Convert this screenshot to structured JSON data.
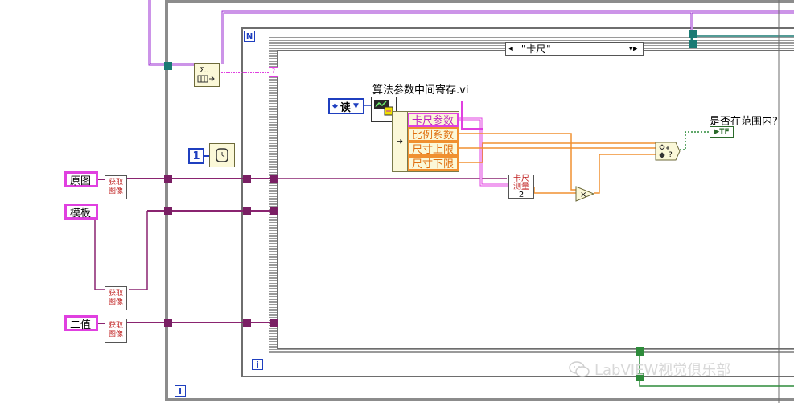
{
  "case_selector": {
    "value": "\"卡尺\"",
    "left_arrow": "◀",
    "right_arrow": "▼▶"
  },
  "terminals": {
    "n": "N",
    "i": "i"
  },
  "loop_count_const": "1",
  "enum_read": {
    "label": "读",
    "arrow": "▼"
  },
  "subvi_name": "算法参数中间寄存.vi",
  "unbundle_items": [
    "卡尺参数",
    "比例系数",
    "尺寸上限",
    "尺寸下限"
  ],
  "images": {
    "original": "原图",
    "template": "模板",
    "binary": "二值"
  },
  "get_image": {
    "label": "获取\n图像"
  },
  "caliper": {
    "line1": "卡尺",
    "line2": "测量",
    "line3": "2"
  },
  "result_label": "是否在范围内?",
  "bool_indicator": "▶TF",
  "watermark": "LabVIEW视觉俱乐部",
  "colors": {
    "pink_wire": "#e040e0",
    "orange_wire": "#f09030",
    "purple_wire": "#9a2ad0",
    "frame": "#8c8c8c"
  }
}
